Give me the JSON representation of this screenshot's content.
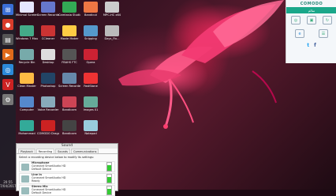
{
  "desktop_icons": [
    {
      "label": "Minimal Screen Recorder",
      "color": "#e6e6ff"
    },
    {
      "label": "Windows 7 Mouse ...",
      "color": "#4a8"
    },
    {
      "label": "Recycle Bin",
      "color": "#7aa"
    },
    {
      "label": "Clean Master",
      "color": "#fb4"
    },
    {
      "label": "Computer",
      "color": "#58c"
    },
    {
      "label": "Mohammad",
      "color": "#3a9"
    },
    {
      "label": "Screen Recorder",
      "color": "#67c"
    },
    {
      "label": "CCleaner",
      "color": "#c33"
    },
    {
      "label": "Desktop",
      "color": "#ddd"
    },
    {
      "label": "Photoshop",
      "color": "#246"
    },
    {
      "label": "Voice Recorder",
      "color": "#8ab"
    },
    {
      "label": "COMODO Dragon",
      "color": "#c22"
    },
    {
      "label": "Camtasia Studio 8",
      "color": "#3a5"
    },
    {
      "label": "Movie Maker",
      "color": "#fc4"
    },
    {
      "label": "FBAHS FTC",
      "color": "#555"
    },
    {
      "label": "Screen Recorder",
      "color": "#68a"
    },
    {
      "label": "Bandicam",
      "color": "#c45"
    },
    {
      "label": "Bandicam",
      "color": "#444"
    },
    {
      "label": "Bandicut",
      "color": "#e74"
    },
    {
      "label": "Snipping",
      "color": "#59c"
    },
    {
      "label": "Opera",
      "color": "#c23"
    },
    {
      "label": "FastStone",
      "color": "#e33"
    },
    {
      "label": "Images 01",
      "color": "#6a9"
    },
    {
      "label": "Notepad",
      "color": "#9cd"
    },
    {
      "label": "MPC-HC x64",
      "color": "#ccc"
    },
    {
      "label": "Days_Fix...",
      "color": "#bbb"
    }
  ],
  "taskbar": {
    "time": "20:55",
    "date": "7/04/2017"
  },
  "comodo": {
    "title": "COMODO",
    "status": "سالم",
    "twitter": "t",
    "facebook": "f"
  },
  "sound_dialog": {
    "title": "Sound",
    "tabs": [
      "Playback",
      "Recording",
      "Sounds",
      "Communications"
    ],
    "active_tab": "Recording",
    "message": "Select a recording device below to modify its settings:",
    "devices": [
      {
        "name": "Microphone",
        "desc": "Conexant SmartAudio HD",
        "status": "Default Device"
      },
      {
        "name": "Line In",
        "desc": "Conexant SmartAudio HD",
        "status": "Ready"
      },
      {
        "name": "Stereo Mix",
        "desc": "Conexant SmartAudio HD",
        "status": "Default Device"
      }
    ]
  }
}
